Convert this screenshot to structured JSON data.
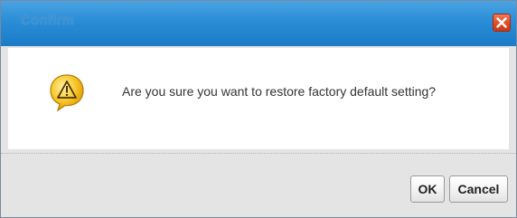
{
  "dialog": {
    "title": "Confirm",
    "message": "Are you sure you want to restore factory default setting?",
    "icon": "warning-icon",
    "close_icon": "close-icon"
  },
  "buttons": {
    "ok_label": "OK",
    "cancel_label": "Cancel"
  },
  "colors": {
    "titlebar": "#2b8dd6",
    "close_button": "#e24d22",
    "warning": "#f5b800"
  }
}
